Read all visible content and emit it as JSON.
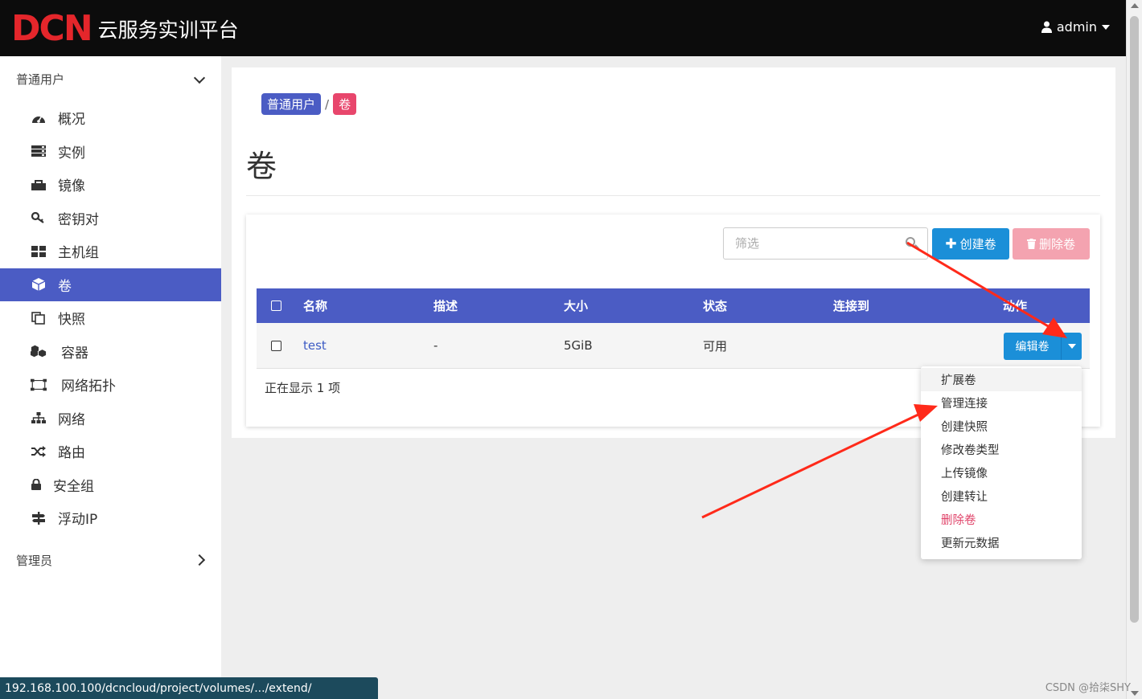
{
  "header": {
    "logo_mark": "DCN",
    "logo_text": "云服务实训平台",
    "user": "admin"
  },
  "sidebar": {
    "group_user": "普通用户",
    "group_admin": "管理员",
    "items": [
      {
        "label": "概况",
        "icon": "dashboard-icon"
      },
      {
        "label": "实例",
        "icon": "server-icon"
      },
      {
        "label": "镜像",
        "icon": "image-icon"
      },
      {
        "label": "密钥对",
        "icon": "key-icon"
      },
      {
        "label": "主机组",
        "icon": "grid-icon"
      },
      {
        "label": "卷",
        "icon": "cube-icon"
      },
      {
        "label": "快照",
        "icon": "copy-icon"
      },
      {
        "label": "容器",
        "icon": "cubes-icon"
      },
      {
        "label": "网络拓扑",
        "icon": "topology-icon"
      },
      {
        "label": "网络",
        "icon": "sitemap-icon"
      },
      {
        "label": "路由",
        "icon": "random-icon"
      },
      {
        "label": "安全组",
        "icon": "lock-icon"
      },
      {
        "label": "浮动IP",
        "icon": "signpost-icon"
      }
    ],
    "active_index": 5
  },
  "breadcrumb": {
    "parent": "普通用户",
    "separator": "/",
    "current": "卷"
  },
  "page": {
    "title": "卷"
  },
  "toolbar": {
    "filter_placeholder": "筛选",
    "create_label": "创建卷",
    "delete_label": "删除卷"
  },
  "table": {
    "columns": [
      "名称",
      "描述",
      "大小",
      "状态",
      "连接到",
      "动作"
    ],
    "rows": [
      {
        "name": "test",
        "description": "-",
        "size": "5GiB",
        "status": "可用",
        "attached_to": "",
        "action": "编辑卷"
      }
    ],
    "count_text": "正在显示 1 项"
  },
  "dropdown": {
    "items": [
      "扩展卷",
      "管理连接",
      "创建快照",
      "修改卷类型",
      "上传镜像",
      "创建转让",
      "删除卷",
      "更新元数据"
    ]
  },
  "status_bar": {
    "url": "192.168.100.100/dcncloud/project/volumes/.../extend/"
  },
  "watermark": "CSDN @拾柒SHY",
  "colors": {
    "primary": "#4b5cc4",
    "button_blue": "#1b8fd8",
    "danger_pink": "#e8466c",
    "arrow_red": "#ff2a1a"
  }
}
